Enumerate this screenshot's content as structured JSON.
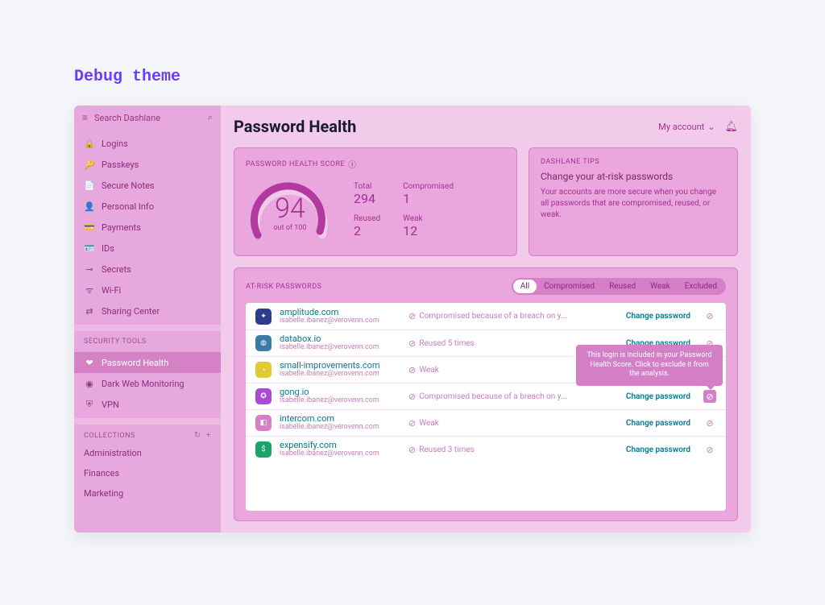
{
  "debug_title": "Debug theme",
  "search": {
    "placeholder": "Search Dashlane"
  },
  "sidebar": {
    "items": [
      {
        "icon": "🔒",
        "label": "Logins"
      },
      {
        "icon": "🔑",
        "label": "Passkeys"
      },
      {
        "icon": "📄",
        "label": "Secure Notes"
      },
      {
        "icon": "👤",
        "label": "Personal Info"
      },
      {
        "icon": "💳",
        "label": "Payments"
      },
      {
        "icon": "🪪",
        "label": "IDs"
      },
      {
        "icon": "⊸",
        "label": "Secrets"
      },
      {
        "icon": "ᯤ",
        "label": "Wi-Fi"
      },
      {
        "icon": "⇄",
        "label": "Sharing Center"
      }
    ],
    "tools_heading": "SECURITY TOOLS",
    "tools": [
      {
        "icon": "❤",
        "label": "Password Health"
      },
      {
        "icon": "◉",
        "label": "Dark Web Monitoring"
      },
      {
        "icon": "⛨",
        "label": "VPN"
      }
    ],
    "collections_heading": "COLLECTIONS",
    "collections": [
      "Administration",
      "Finances",
      "Marketing"
    ]
  },
  "header": {
    "title": "Password Health",
    "account": "My account"
  },
  "score_card": {
    "heading": "PASSWORD HEALTH SCORE",
    "score": "94",
    "out_of": "out of 100",
    "stats": {
      "total_label": "Total",
      "total_value": "294",
      "compromised_label": "Compromised",
      "compromised_value": "1",
      "reused_label": "Reused",
      "reused_value": "2",
      "weak_label": "Weak",
      "weak_value": "12"
    }
  },
  "tips_card": {
    "heading": "DASHLANE TIPS",
    "title": "Change your at-risk passwords",
    "body": "Your accounts are more secure when you change all passwords that are compromised, reused, or weak."
  },
  "risk": {
    "heading": "AT-RISK PASSWORDS",
    "filters": [
      "All",
      "Compromised",
      "Reused",
      "Weak",
      "Excluded"
    ],
    "change_label": "Change password",
    "tooltip": "This login is included in your Password Health Score. Click to exclude it from the analysis.",
    "rows": [
      {
        "site": "amplitude.com",
        "email": "isabelle.ibanez@verovenn.com",
        "reason": "Compromised because of a breach on y...",
        "icon_bg": "#2e3a8c",
        "icon_txt": "✦"
      },
      {
        "site": "databox.io",
        "email": "isabelle.ibanez@verovenn.com",
        "reason": "Reused 5 times",
        "icon_bg": "#3a7ca5",
        "icon_txt": "◍"
      },
      {
        "site": "small-improvements.com",
        "email": "isabelle.ibanez@verovenn.com",
        "reason": "Weak",
        "icon_bg": "#e3c936",
        "icon_txt": "◔"
      },
      {
        "site": "gong.io",
        "email": "isabelle.ibanez@verovenn.com",
        "reason": "Compromised because of a breach on y...",
        "icon_bg": "#a94bd3",
        "icon_txt": "✪"
      },
      {
        "site": "intercom.com",
        "email": "isabelle.ibanez@verovenn.com",
        "reason": "Weak",
        "icon_bg": "#d47fc8",
        "icon_txt": "◧"
      },
      {
        "site": "expensify.com",
        "email": "isabelle.ibanez@verovenn.com",
        "reason": "Reused 3 times",
        "icon_bg": "#1aa36b",
        "icon_txt": "$"
      }
    ]
  }
}
